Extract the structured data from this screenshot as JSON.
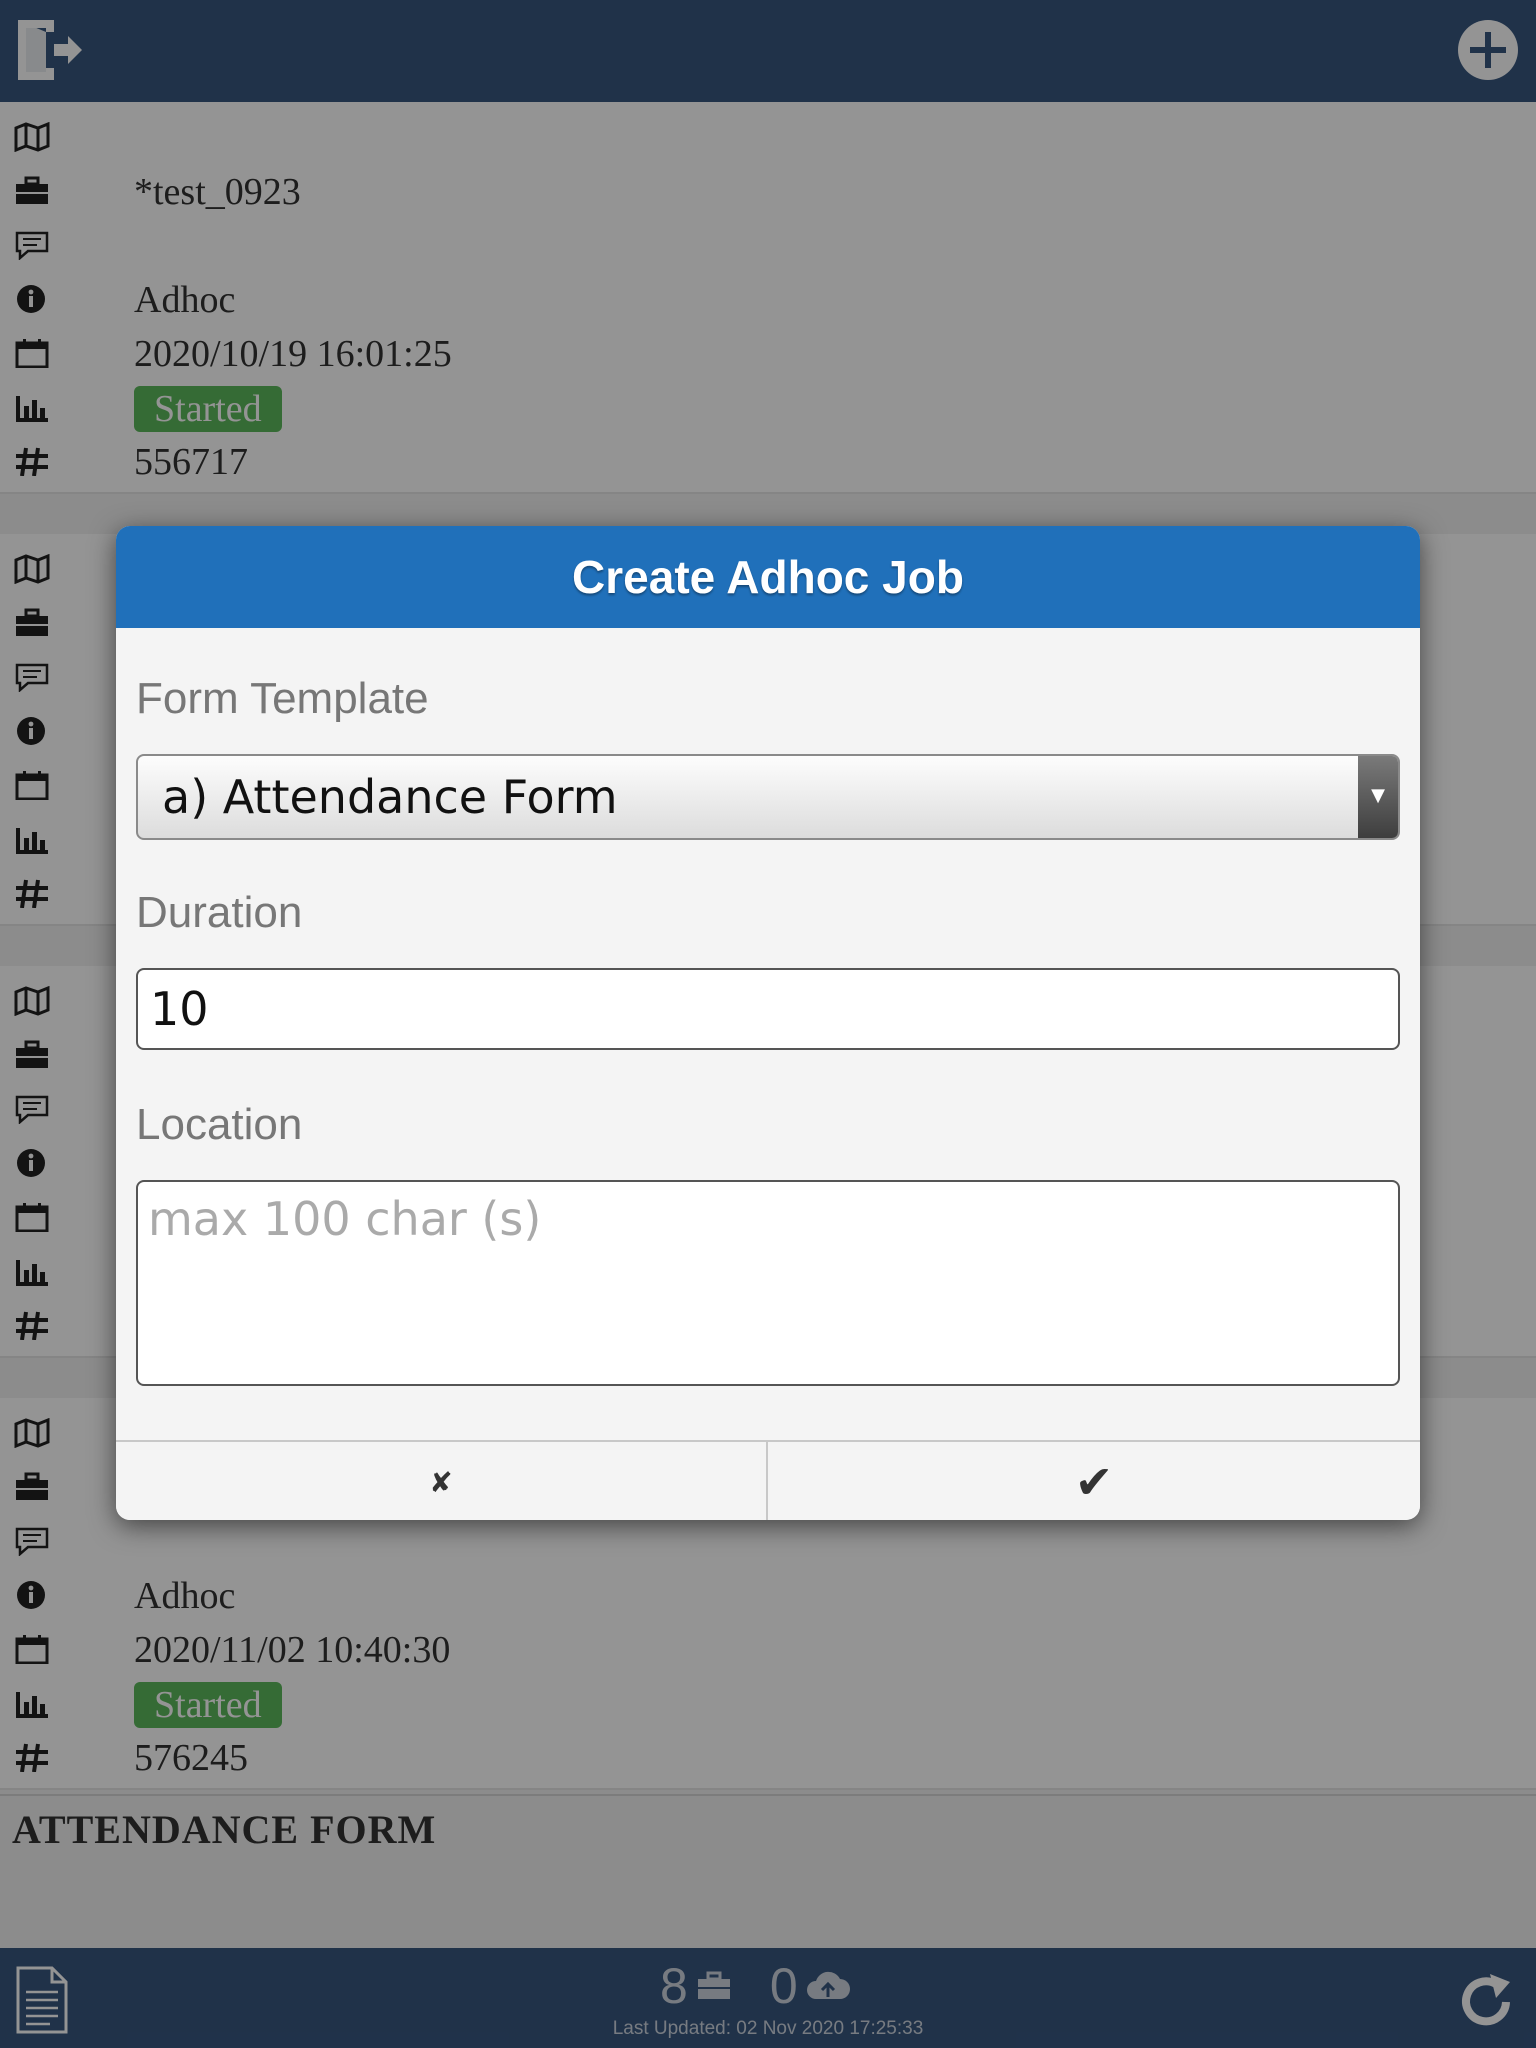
{
  "header": {
    "logout_icon": "logout-icon",
    "add_icon": "add-circle-icon"
  },
  "jobs": [
    {
      "map": "",
      "name": "*test_0923",
      "comment": "",
      "type": "Adhoc",
      "date": "2020/10/19 16:01:25",
      "status": "Started",
      "id": "556717"
    },
    {
      "map": "",
      "name": "",
      "comment": "",
      "type": "",
      "date": "",
      "status": "",
      "id": ""
    },
    {
      "map": "",
      "name": "",
      "comment": "",
      "type": "",
      "date": "",
      "status": "",
      "id": ""
    },
    {
      "map": "",
      "name": "",
      "comment": "",
      "type": "Adhoc",
      "date": "2020/11/02 10:40:30",
      "status": "Started",
      "id": "576245"
    }
  ],
  "section_title": "ATTENDANCE FORM",
  "dialog": {
    "title": "Create Adhoc Job",
    "form_template_label": "Form Template",
    "form_template_value": "a) Attendance Form",
    "duration_label": "Duration",
    "duration_value": "10",
    "location_label": "Location",
    "location_placeholder": "max 100 char (s)",
    "location_value": "",
    "cancel_glyph": "✘",
    "ok_glyph": "✔"
  },
  "footer": {
    "jobs_count": "8",
    "upload_count": "0",
    "last_updated": "Last Updated: 02 Nov 2020 17:25:33"
  },
  "colors": {
    "header": "#37577f",
    "dialog_header": "#2070ba",
    "badge": "#5cb85c"
  }
}
